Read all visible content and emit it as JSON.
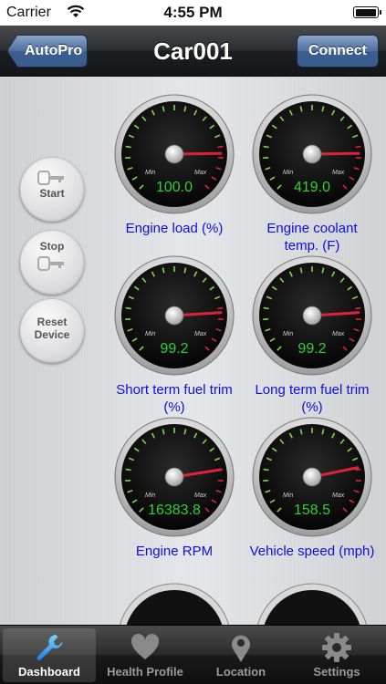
{
  "status": {
    "carrier": "Carrier",
    "time": "4:55 PM"
  },
  "nav": {
    "back_label": "AutoPro",
    "title": "Car001",
    "connect_label": "Connect"
  },
  "side_buttons": [
    {
      "label": "Start",
      "icon": "key-icon"
    },
    {
      "label": "Stop",
      "icon": "key-icon"
    },
    {
      "label": "Reset Device",
      "line1": "Reset",
      "line2": "Device"
    }
  ],
  "gauges": [
    {
      "value": "100.0",
      "label1": "Engine load (%)",
      "label2": "",
      "level": 0.83
    },
    {
      "value": "419.0",
      "label1": "Engine coolant",
      "label2": "temp. (F)",
      "level": 0.83
    },
    {
      "value": "99.2",
      "label1": "Short term fuel trim",
      "label2": "(%)",
      "level": 0.82
    },
    {
      "value": "99.2",
      "label1": "Long term fuel trim",
      "label2": "(%)",
      "level": 0.82
    },
    {
      "value": "16383.8",
      "label1": "Engine RPM",
      "label2": "",
      "level": 0.8
    },
    {
      "value": "158.5",
      "label1": "Vehicle speed (mph)",
      "label2": "",
      "level": 0.79
    }
  ],
  "gauge_scale": {
    "min_label": "Min",
    "max_label": "Max"
  },
  "tabs": [
    {
      "label": "Dashboard",
      "icon": "wrench-icon",
      "active": true
    },
    {
      "label": "Health Profile",
      "icon": "heart-icon",
      "active": false
    },
    {
      "label": "Location",
      "icon": "map-pin-icon",
      "active": false
    },
    {
      "label": "Settings",
      "icon": "gear-icon",
      "active": false
    }
  ],
  "colors": {
    "gauge_value": "#2fd12f",
    "label_blue": "#0a10e0",
    "needle": "#e0203a",
    "nav_button": "#4e6f9f"
  }
}
